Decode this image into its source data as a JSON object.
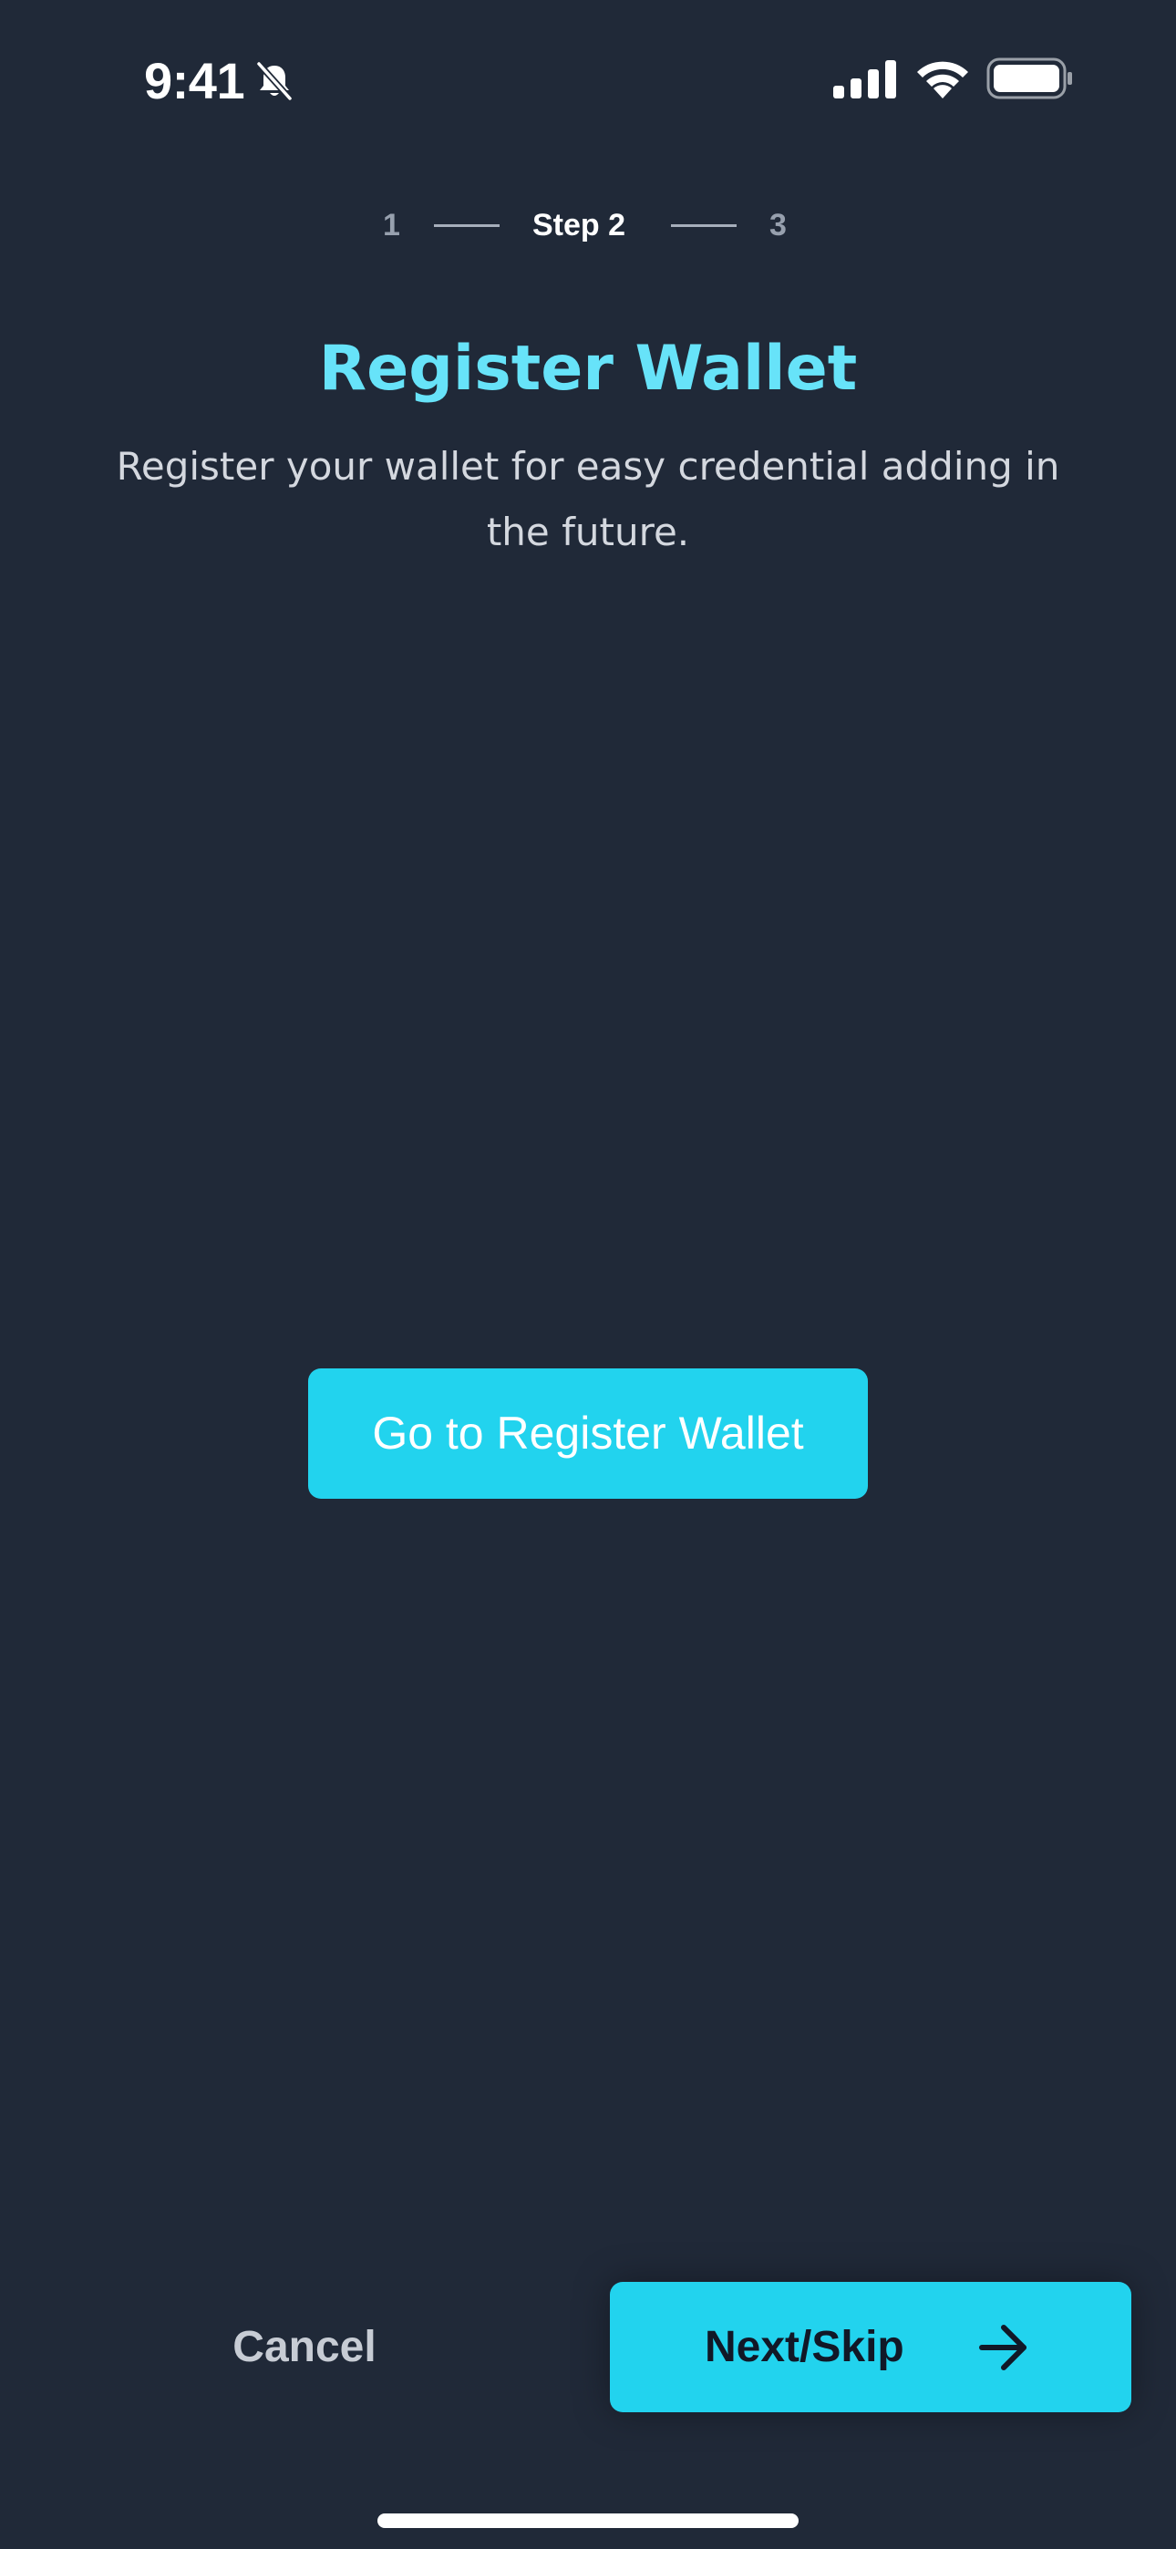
{
  "status_bar": {
    "time": "9:41"
  },
  "stepper": {
    "step1": "1",
    "current": "Step 2",
    "step3": "3"
  },
  "content": {
    "title": "Register Wallet",
    "subtitle": "Register your wallet for easy credential adding in the future."
  },
  "actions": {
    "register_label": "Go to Register Wallet",
    "cancel_label": "Cancel",
    "next_label": "Next/Skip"
  },
  "colors": {
    "background": "#202938",
    "accent": "#22d3ee",
    "title": "#67e3f9"
  },
  "icons": {
    "bell": "bell-slash-icon",
    "signal": "cellular-signal-icon",
    "wifi": "wifi-icon",
    "battery": "battery-icon",
    "arrow": "arrow-right-icon"
  }
}
